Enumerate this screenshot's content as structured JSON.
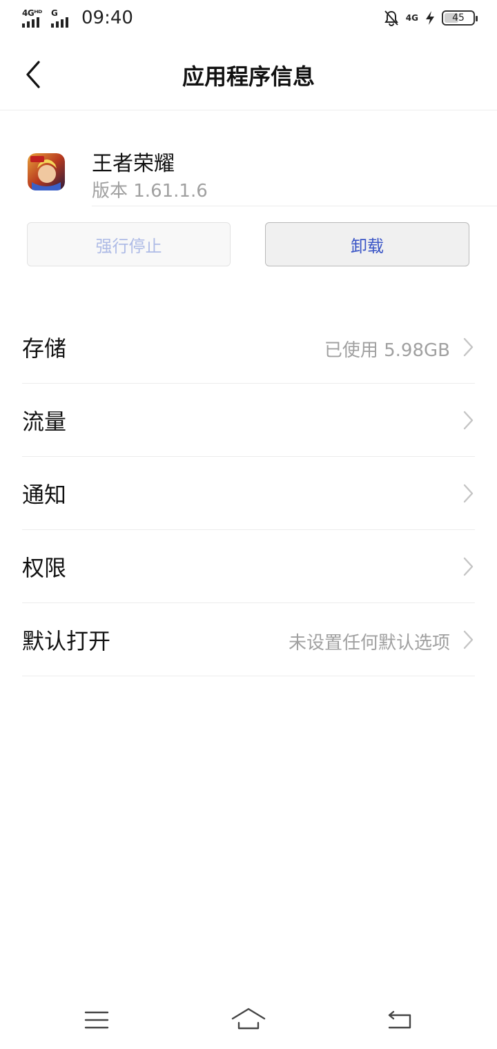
{
  "status_bar": {
    "sim1_tag": "4Gᴴᴰ",
    "sim2_tag": "G",
    "time": "09:40",
    "network_right": "4G",
    "battery_level": "45",
    "icons": [
      "signal-icon",
      "signal-icon",
      "bell-off-icon",
      "charging-icon",
      "battery-icon"
    ]
  },
  "header": {
    "title": "应用程序信息",
    "back_icon": "back-arrow-icon"
  },
  "app": {
    "name": "王者荣耀",
    "version": "版本 1.61.1.6"
  },
  "actions": {
    "force_stop_label": "强行停止",
    "uninstall_label": "卸载"
  },
  "settings": [
    {
      "label": "存储",
      "value": "已使用 5.98GB"
    },
    {
      "label": "流量",
      "value": ""
    },
    {
      "label": "通知",
      "value": ""
    },
    {
      "label": "权限",
      "value": ""
    },
    {
      "label": "默认打开",
      "value": "未设置任何默认选项"
    }
  ],
  "nav_bar": {
    "icons": [
      "menu-icon",
      "home-icon",
      "return-icon"
    ]
  },
  "colors": {
    "disabled_text": "#aebbe6",
    "accent": "#3a55c6",
    "secondary_text": "#a0a0a0",
    "divider": "#ececec"
  }
}
